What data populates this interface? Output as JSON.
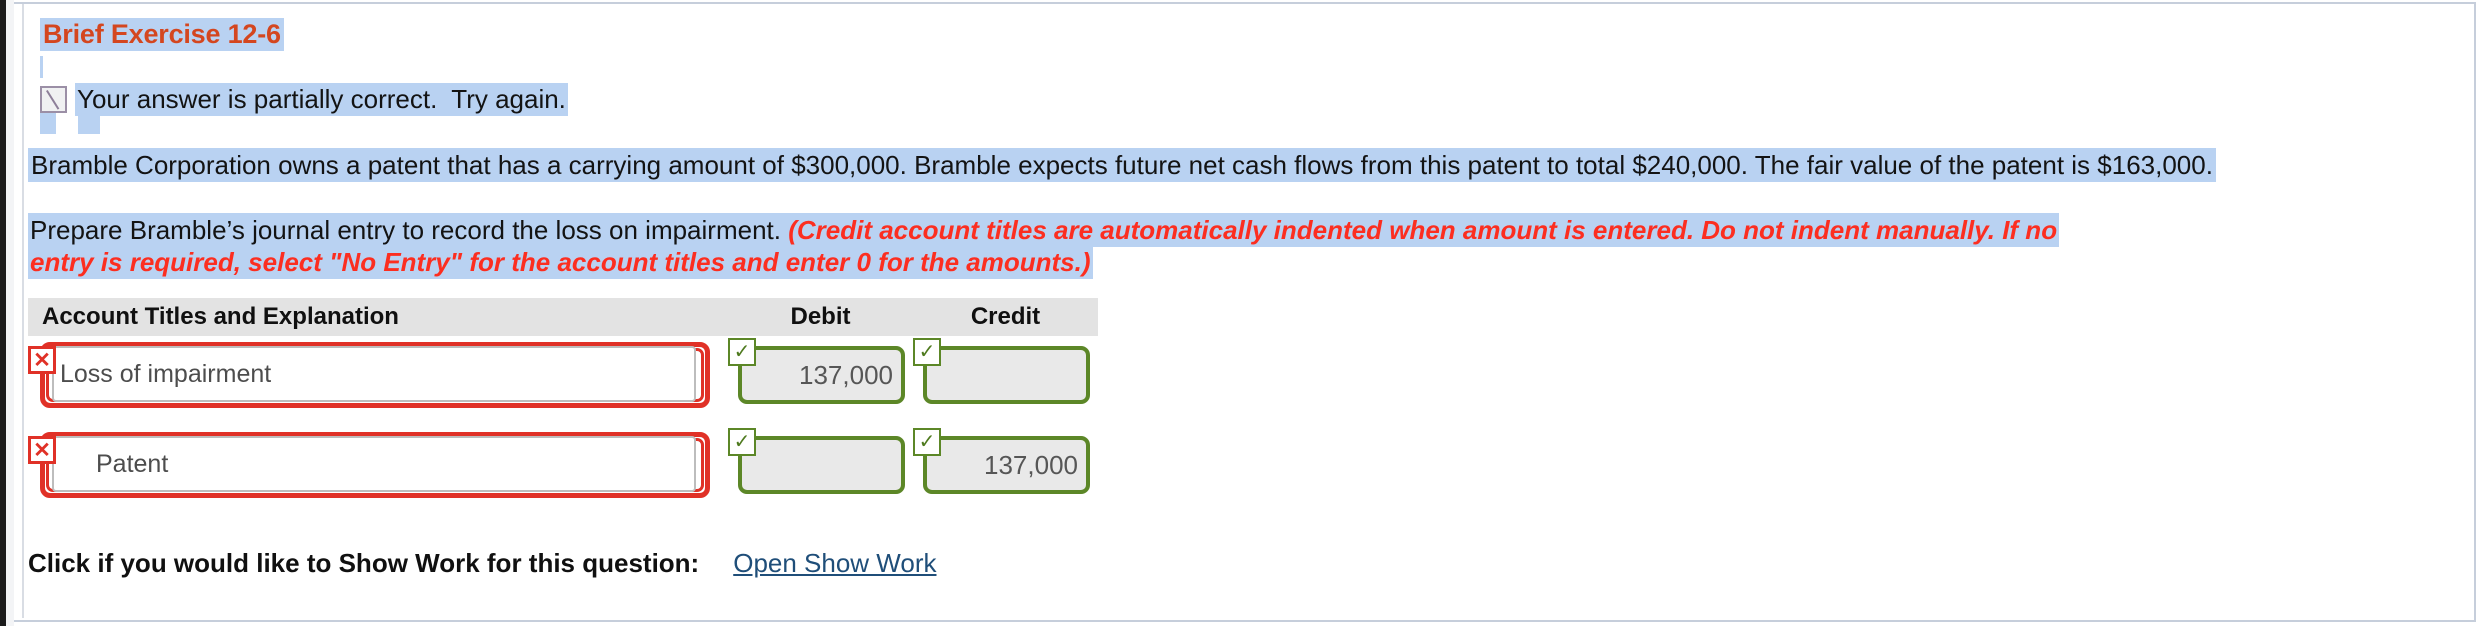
{
  "exercise": {
    "title": "Brief Exercise 12-6"
  },
  "status": {
    "icon": "partially-correct-slash-icon",
    "message": "Your answer is partially correct.  Try again."
  },
  "problem": {
    "fact_text": "Bramble Corporation owns a patent that has a carrying amount of $300,000. Bramble expects future net cash flows from this patent to total $240,000. The fair value of the patent is $163,000.",
    "instruction_text": "Prepare Bramble’s journal entry to record the loss on impairment. ",
    "instruction_note": "(Credit account titles are automatically indented when amount is entered. Do not indent manually. If no entry is required, select \"No Entry\" for the account titles and enter 0 for the amounts.)"
  },
  "journal": {
    "headers": {
      "account": "Account Titles and Explanation",
      "debit": "Debit",
      "credit": "Credit"
    },
    "rows": [
      {
        "account": "Loss of impairment",
        "account_status": "incorrect",
        "account_badge": "✕",
        "indented": false,
        "debit": "137,000",
        "debit_status": "correct",
        "debit_badge": "✓",
        "credit": "",
        "credit_status": "correct",
        "credit_badge": "✓"
      },
      {
        "account": "Patent",
        "account_status": "incorrect",
        "account_badge": "✕",
        "indented": true,
        "debit": "",
        "debit_status": "correct",
        "debit_badge": "✓",
        "credit": "137,000",
        "credit_status": "correct",
        "credit_badge": "✓"
      }
    ]
  },
  "footer": {
    "label": "Click if you would like to Show Work for this question:",
    "link": "Open Show Work"
  },
  "colors": {
    "title": "#d4461f",
    "highlight": "#b9d2f2",
    "note_red": "#fc2e20",
    "incorrect_border": "#e03127",
    "correct_border": "#5c8727",
    "link": "#1f4e79",
    "header_bg": "#e3e3e3"
  }
}
